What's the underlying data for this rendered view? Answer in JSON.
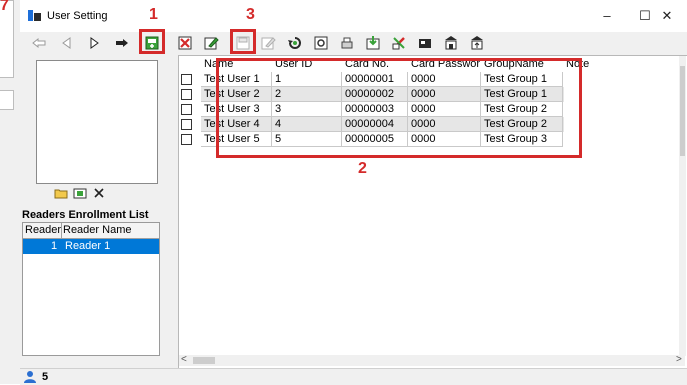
{
  "background_app": {
    "annotation": "7"
  },
  "window": {
    "title": "User Setting",
    "minimize_glyph": "–",
    "maximize_glyph": "☐",
    "close_glyph": "✕"
  },
  "toolbar": {
    "icons": [
      "first-record-icon",
      "prev-record-icon",
      "next-record-icon",
      "last-record-icon",
      "add-user-icon",
      "delete-user-icon",
      "edit-user-icon",
      "save-user-icon",
      "cancel-edit-icon",
      "refresh-icon",
      "search-icon",
      "print-icon",
      "import-icon",
      "export-icon",
      "card-issue-icon",
      "enroll-icon",
      "upload-icon"
    ]
  },
  "annotations": {
    "a1": "1",
    "a2": "2",
    "a3": "3"
  },
  "enrollment": {
    "title": "Readers Enrollment List",
    "columns": [
      "Reader",
      "Reader Name"
    ],
    "rows": [
      {
        "reader": "1",
        "name": "Reader 1"
      }
    ]
  },
  "users": {
    "columns": [
      "Name",
      "User ID",
      "Card No.",
      "Card Passwor",
      "GroupName",
      "Note"
    ],
    "rows": [
      [
        "Test User 1",
        "1",
        "00000001",
        "0000",
        "Test Group 1",
        ""
      ],
      [
        "Test User 2",
        "2",
        "00000002",
        "0000",
        "Test Group 1",
        ""
      ],
      [
        "Test User 3",
        "3",
        "00000003",
        "0000",
        "Test Group 2",
        ""
      ],
      [
        "Test User 4",
        "4",
        "00000004",
        "0000",
        "Test Group 2",
        ""
      ],
      [
        "Test User 5",
        "5",
        "00000005",
        "0000",
        "Test Group 3",
        ""
      ]
    ]
  },
  "scroll": {
    "left_arrow": "<",
    "right_arrow": ">"
  },
  "status": {
    "count": "5"
  },
  "colors": {
    "accent": "#d42a2a",
    "selection": "#0078d7"
  }
}
